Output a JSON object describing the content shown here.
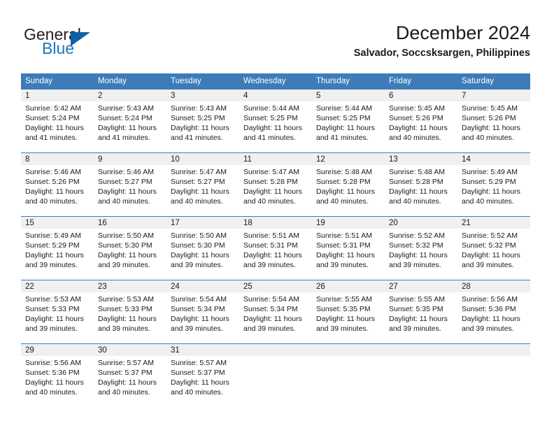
{
  "logo": {
    "primary_text": "General",
    "secondary_text": "Blue",
    "triangle_icon": "triangle-icon",
    "brand_blue": "#1878c0",
    "triangle_blue": "#1060a8"
  },
  "header": {
    "title": "December 2024",
    "location": "Salvador, Soccsksargen, Philippines"
  },
  "calendar": {
    "header_color": "#3d7cb8",
    "weekdays": [
      "Sunday",
      "Monday",
      "Tuesday",
      "Wednesday",
      "Thursday",
      "Friday",
      "Saturday"
    ],
    "weeks": [
      [
        {
          "day": "1",
          "sunrise": "Sunrise: 5:42 AM",
          "sunset": "Sunset: 5:24 PM",
          "daylight_line1": "Daylight: 11 hours",
          "daylight_line2": "and 41 minutes."
        },
        {
          "day": "2",
          "sunrise": "Sunrise: 5:43 AM",
          "sunset": "Sunset: 5:24 PM",
          "daylight_line1": "Daylight: 11 hours",
          "daylight_line2": "and 41 minutes."
        },
        {
          "day": "3",
          "sunrise": "Sunrise: 5:43 AM",
          "sunset": "Sunset: 5:25 PM",
          "daylight_line1": "Daylight: 11 hours",
          "daylight_line2": "and 41 minutes."
        },
        {
          "day": "4",
          "sunrise": "Sunrise: 5:44 AM",
          "sunset": "Sunset: 5:25 PM",
          "daylight_line1": "Daylight: 11 hours",
          "daylight_line2": "and 41 minutes."
        },
        {
          "day": "5",
          "sunrise": "Sunrise: 5:44 AM",
          "sunset": "Sunset: 5:25 PM",
          "daylight_line1": "Daylight: 11 hours",
          "daylight_line2": "and 41 minutes."
        },
        {
          "day": "6",
          "sunrise": "Sunrise: 5:45 AM",
          "sunset": "Sunset: 5:26 PM",
          "daylight_line1": "Daylight: 11 hours",
          "daylight_line2": "and 40 minutes."
        },
        {
          "day": "7",
          "sunrise": "Sunrise: 5:45 AM",
          "sunset": "Sunset: 5:26 PM",
          "daylight_line1": "Daylight: 11 hours",
          "daylight_line2": "and 40 minutes."
        }
      ],
      [
        {
          "day": "8",
          "sunrise": "Sunrise: 5:46 AM",
          "sunset": "Sunset: 5:26 PM",
          "daylight_line1": "Daylight: 11 hours",
          "daylight_line2": "and 40 minutes."
        },
        {
          "day": "9",
          "sunrise": "Sunrise: 5:46 AM",
          "sunset": "Sunset: 5:27 PM",
          "daylight_line1": "Daylight: 11 hours",
          "daylight_line2": "and 40 minutes."
        },
        {
          "day": "10",
          "sunrise": "Sunrise: 5:47 AM",
          "sunset": "Sunset: 5:27 PM",
          "daylight_line1": "Daylight: 11 hours",
          "daylight_line2": "and 40 minutes."
        },
        {
          "day": "11",
          "sunrise": "Sunrise: 5:47 AM",
          "sunset": "Sunset: 5:28 PM",
          "daylight_line1": "Daylight: 11 hours",
          "daylight_line2": "and 40 minutes."
        },
        {
          "day": "12",
          "sunrise": "Sunrise: 5:48 AM",
          "sunset": "Sunset: 5:28 PM",
          "daylight_line1": "Daylight: 11 hours",
          "daylight_line2": "and 40 minutes."
        },
        {
          "day": "13",
          "sunrise": "Sunrise: 5:48 AM",
          "sunset": "Sunset: 5:28 PM",
          "daylight_line1": "Daylight: 11 hours",
          "daylight_line2": "and 40 minutes."
        },
        {
          "day": "14",
          "sunrise": "Sunrise: 5:49 AM",
          "sunset": "Sunset: 5:29 PM",
          "daylight_line1": "Daylight: 11 hours",
          "daylight_line2": "and 40 minutes."
        }
      ],
      [
        {
          "day": "15",
          "sunrise": "Sunrise: 5:49 AM",
          "sunset": "Sunset: 5:29 PM",
          "daylight_line1": "Daylight: 11 hours",
          "daylight_line2": "and 39 minutes."
        },
        {
          "day": "16",
          "sunrise": "Sunrise: 5:50 AM",
          "sunset": "Sunset: 5:30 PM",
          "daylight_line1": "Daylight: 11 hours",
          "daylight_line2": "and 39 minutes."
        },
        {
          "day": "17",
          "sunrise": "Sunrise: 5:50 AM",
          "sunset": "Sunset: 5:30 PM",
          "daylight_line1": "Daylight: 11 hours",
          "daylight_line2": "and 39 minutes."
        },
        {
          "day": "18",
          "sunrise": "Sunrise: 5:51 AM",
          "sunset": "Sunset: 5:31 PM",
          "daylight_line1": "Daylight: 11 hours",
          "daylight_line2": "and 39 minutes."
        },
        {
          "day": "19",
          "sunrise": "Sunrise: 5:51 AM",
          "sunset": "Sunset: 5:31 PM",
          "daylight_line1": "Daylight: 11 hours",
          "daylight_line2": "and 39 minutes."
        },
        {
          "day": "20",
          "sunrise": "Sunrise: 5:52 AM",
          "sunset": "Sunset: 5:32 PM",
          "daylight_line1": "Daylight: 11 hours",
          "daylight_line2": "and 39 minutes."
        },
        {
          "day": "21",
          "sunrise": "Sunrise: 5:52 AM",
          "sunset": "Sunset: 5:32 PM",
          "daylight_line1": "Daylight: 11 hours",
          "daylight_line2": "and 39 minutes."
        }
      ],
      [
        {
          "day": "22",
          "sunrise": "Sunrise: 5:53 AM",
          "sunset": "Sunset: 5:33 PM",
          "daylight_line1": "Daylight: 11 hours",
          "daylight_line2": "and 39 minutes."
        },
        {
          "day": "23",
          "sunrise": "Sunrise: 5:53 AM",
          "sunset": "Sunset: 5:33 PM",
          "daylight_line1": "Daylight: 11 hours",
          "daylight_line2": "and 39 minutes."
        },
        {
          "day": "24",
          "sunrise": "Sunrise: 5:54 AM",
          "sunset": "Sunset: 5:34 PM",
          "daylight_line1": "Daylight: 11 hours",
          "daylight_line2": "and 39 minutes."
        },
        {
          "day": "25",
          "sunrise": "Sunrise: 5:54 AM",
          "sunset": "Sunset: 5:34 PM",
          "daylight_line1": "Daylight: 11 hours",
          "daylight_line2": "and 39 minutes."
        },
        {
          "day": "26",
          "sunrise": "Sunrise: 5:55 AM",
          "sunset": "Sunset: 5:35 PM",
          "daylight_line1": "Daylight: 11 hours",
          "daylight_line2": "and 39 minutes."
        },
        {
          "day": "27",
          "sunrise": "Sunrise: 5:55 AM",
          "sunset": "Sunset: 5:35 PM",
          "daylight_line1": "Daylight: 11 hours",
          "daylight_line2": "and 39 minutes."
        },
        {
          "day": "28",
          "sunrise": "Sunrise: 5:56 AM",
          "sunset": "Sunset: 5:36 PM",
          "daylight_line1": "Daylight: 11 hours",
          "daylight_line2": "and 39 minutes."
        }
      ],
      [
        {
          "day": "29",
          "sunrise": "Sunrise: 5:56 AM",
          "sunset": "Sunset: 5:36 PM",
          "daylight_line1": "Daylight: 11 hours",
          "daylight_line2": "and 40 minutes."
        },
        {
          "day": "30",
          "sunrise": "Sunrise: 5:57 AM",
          "sunset": "Sunset: 5:37 PM",
          "daylight_line1": "Daylight: 11 hours",
          "daylight_line2": "and 40 minutes."
        },
        {
          "day": "31",
          "sunrise": "Sunrise: 5:57 AM",
          "sunset": "Sunset: 5:37 PM",
          "daylight_line1": "Daylight: 11 hours",
          "daylight_line2": "and 40 minutes."
        },
        {
          "day": "",
          "sunrise": "",
          "sunset": "",
          "daylight_line1": "",
          "daylight_line2": ""
        },
        {
          "day": "",
          "sunrise": "",
          "sunset": "",
          "daylight_line1": "",
          "daylight_line2": ""
        },
        {
          "day": "",
          "sunrise": "",
          "sunset": "",
          "daylight_line1": "",
          "daylight_line2": ""
        },
        {
          "day": "",
          "sunrise": "",
          "sunset": "",
          "daylight_line1": "",
          "daylight_line2": ""
        }
      ]
    ]
  }
}
